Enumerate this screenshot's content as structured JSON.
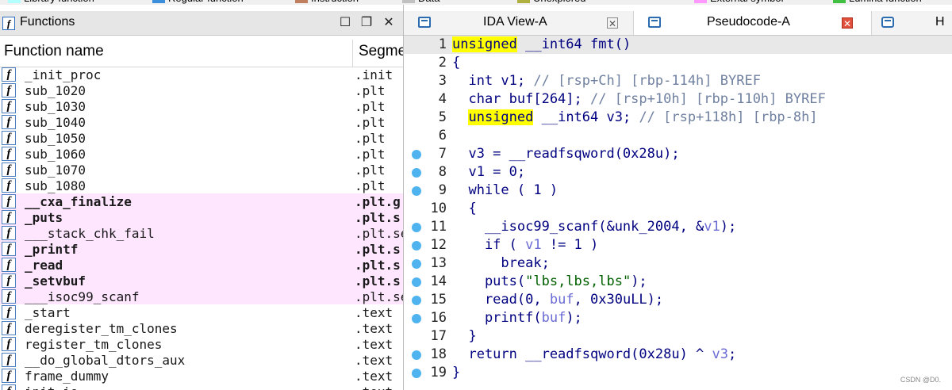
{
  "legend": {
    "items": [
      {
        "label": "Library function",
        "color": "#b3ffff"
      },
      {
        "label": "Regular function",
        "color": "#3b8fdb"
      },
      {
        "label": "Instruction",
        "color": "#c08060"
      },
      {
        "label": "Data",
        "color": "#c0c0c0"
      },
      {
        "label": "Unexplored",
        "color": "#b0b040"
      },
      {
        "label": "External symbol",
        "color": "#ff99ff"
      },
      {
        "label": "Lumina function",
        "color": "#40c040"
      }
    ]
  },
  "functions_pane": {
    "title": "Functions",
    "columns": {
      "name": "Function name",
      "segment": "Segme"
    },
    "rows": [
      {
        "name": "_init_proc",
        "segment": ".init",
        "highlight": false,
        "bold": false
      },
      {
        "name": "sub_1020",
        "segment": ".plt",
        "highlight": false,
        "bold": false
      },
      {
        "name": "sub_1030",
        "segment": ".plt",
        "highlight": false,
        "bold": false
      },
      {
        "name": "sub_1040",
        "segment": ".plt",
        "highlight": false,
        "bold": false
      },
      {
        "name": "sub_1050",
        "segment": ".plt",
        "highlight": false,
        "bold": false
      },
      {
        "name": "sub_1060",
        "segment": ".plt",
        "highlight": false,
        "bold": false
      },
      {
        "name": "sub_1070",
        "segment": ".plt",
        "highlight": false,
        "bold": false
      },
      {
        "name": "sub_1080",
        "segment": ".plt",
        "highlight": false,
        "bold": false
      },
      {
        "name": "__cxa_finalize",
        "segment": ".plt.g",
        "highlight": true,
        "bold": true
      },
      {
        "name": "_puts",
        "segment": ".plt.s",
        "highlight": true,
        "bold": true
      },
      {
        "name": "___stack_chk_fail",
        "segment": ".plt.se",
        "highlight": true,
        "bold": false
      },
      {
        "name": "_printf",
        "segment": ".plt.s",
        "highlight": true,
        "bold": true
      },
      {
        "name": "_read",
        "segment": ".plt.s",
        "highlight": true,
        "bold": true
      },
      {
        "name": "_setvbuf",
        "segment": ".plt.s",
        "highlight": true,
        "bold": true
      },
      {
        "name": "___isoc99_scanf",
        "segment": ".plt.se",
        "highlight": true,
        "bold": false
      },
      {
        "name": "_start",
        "segment": ".text",
        "highlight": false,
        "bold": false
      },
      {
        "name": "deregister_tm_clones",
        "segment": ".text",
        "highlight": false,
        "bold": false
      },
      {
        "name": "register_tm_clones",
        "segment": ".text",
        "highlight": false,
        "bold": false
      },
      {
        "name": "__do_global_dtors_aux",
        "segment": ".text",
        "highlight": false,
        "bold": false
      },
      {
        "name": "frame_dummy",
        "segment": ".text",
        "highlight": false,
        "bold": false
      },
      {
        "name": "init_io",
        "segment": ".text",
        "highlight": false,
        "bold": false
      }
    ]
  },
  "tabs": [
    {
      "label": "IDA View-A",
      "active": false
    },
    {
      "label": "Pseudocode-A",
      "active": true
    },
    {
      "label": "H",
      "active": false
    }
  ],
  "pseudocode": {
    "lines": [
      {
        "n": "1",
        "bp": false,
        "html": "<span class=\"caret\"></span><span class=\"kw-hl\">unsigned</span> __int64 fmt()"
      },
      {
        "n": "2",
        "bp": false,
        "html": "{"
      },
      {
        "n": "3",
        "bp": false,
        "html": "  int v1; <span class=\"cmt\">// [rsp+Ch] [rbp-114h] BYREF</span>"
      },
      {
        "n": "4",
        "bp": false,
        "html": "  char buf[264]; <span class=\"cmt\">// [rsp+10h] [rbp-110h] BYREF</span>"
      },
      {
        "n": "5",
        "bp": false,
        "html": "  <span class=\"kw-hl\">unsigned</span> __int64 v3; <span class=\"cmt\">// [rsp+118h] [rbp-8h]</span>"
      },
      {
        "n": "6",
        "bp": false,
        "html": ""
      },
      {
        "n": "7",
        "bp": true,
        "html": "  v3 = __readfsqword(0x28u);"
      },
      {
        "n": "8",
        "bp": true,
        "html": "  v1 = 0;"
      },
      {
        "n": "9",
        "bp": true,
        "html": "  while ( 1 )"
      },
      {
        "n": "10",
        "bp": false,
        "html": "  {"
      },
      {
        "n": "11",
        "bp": true,
        "html": "    __isoc99_scanf(&amp;unk_2004, &amp;<span class=\"var\">v1</span>);"
      },
      {
        "n": "12",
        "bp": true,
        "html": "    if ( <span class=\"var\">v1</span> != 1 )"
      },
      {
        "n": "13",
        "bp": true,
        "html": "      break;"
      },
      {
        "n": "14",
        "bp": true,
        "html": "    puts(<span class=\"str\">\"lbs,lbs,lbs\"</span>);"
      },
      {
        "n": "15",
        "bp": true,
        "html": "    read(0, <span class=\"var\">buf</span>, 0x30uLL);"
      },
      {
        "n": "16",
        "bp": true,
        "html": "    printf(<span class=\"var\">buf</span>);"
      },
      {
        "n": "17",
        "bp": false,
        "html": "  }"
      },
      {
        "n": "18",
        "bp": true,
        "html": "  return __readfsqword(0x28u) ^ <span class=\"var\">v3</span>;"
      },
      {
        "n": "19",
        "bp": true,
        "html": "}"
      }
    ]
  },
  "watermark": "CSDN @D0."
}
